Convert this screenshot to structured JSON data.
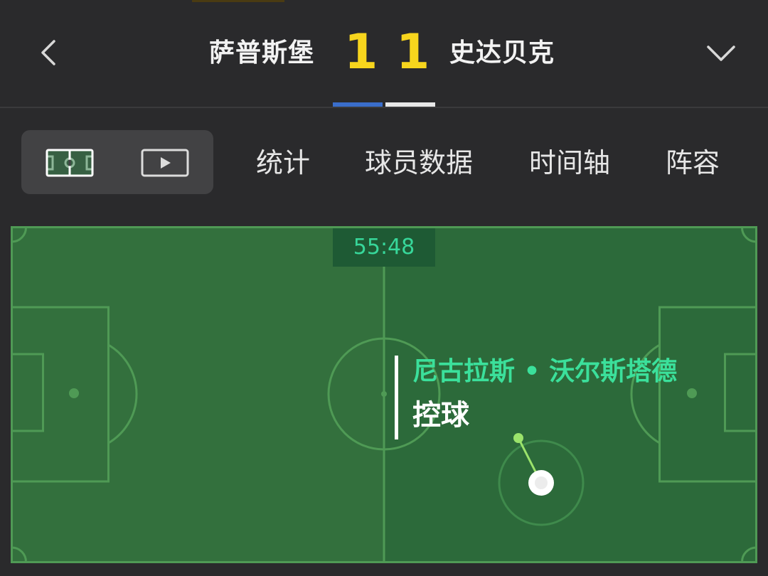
{
  "header": {
    "home_team": "萨普斯堡",
    "home_score": "1",
    "away_score": "1",
    "away_team": "史达贝克",
    "back_icon": "chevron-left-icon",
    "dropdown_icon": "chevron-down-icon"
  },
  "view_modes": [
    {
      "icon": "football-pitch-icon",
      "selected": true
    },
    {
      "icon": "video-play-icon",
      "selected": false
    }
  ],
  "tabs": [
    "统计",
    "球员数据",
    "时间轴",
    "阵容"
  ],
  "pitch": {
    "clock": "55:48",
    "event_player": "尼古拉斯 • 沃尔斯塔德",
    "event_action": "控球"
  },
  "colors": {
    "background": "#2a2a2c",
    "score": "#f7d51d",
    "home_indicator": "#3a6ecb",
    "away_indicator": "#e8e8e8",
    "pitch_left": "#33703d",
    "pitch_right": "#2c6a3a",
    "pitch_lines": "#4f9a55",
    "player_name": "#3be09b",
    "clock_text": "#37d79a"
  }
}
